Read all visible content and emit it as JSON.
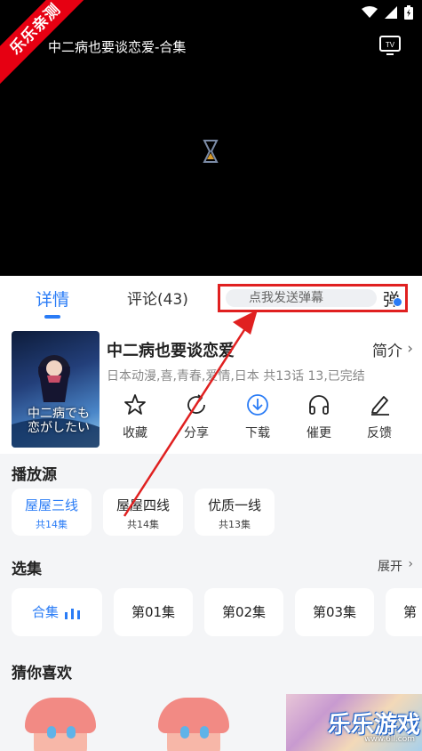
{
  "status_bar": {
    "wifi_icon": "wifi-icon",
    "signal_icon": "signal-icon",
    "battery_icon": "battery-charging-icon"
  },
  "player": {
    "title": "中二病也要谈恋爱-合集",
    "tv_icon": "tv-cast-icon",
    "tv_label": "TV",
    "loading_icon": "hourglass-icon",
    "ribbon": "乐乐亲测"
  },
  "tabs": {
    "detail": "详情",
    "comments": "评论(43)"
  },
  "danmaku": {
    "placeholder": "点我发送弹幕",
    "toggle": "弹"
  },
  "show": {
    "title": "中二病也要谈恋爱",
    "intro": "简介",
    "meta": "日本动漫,喜,青春,爱情,日本 共13话 13,已完结",
    "poster_text": "中二病でも恋がしたい"
  },
  "actions": [
    {
      "label": "收藏",
      "icon": "star-icon"
    },
    {
      "label": "分享",
      "icon": "share-icon"
    },
    {
      "label": "下载",
      "icon": "download-icon"
    },
    {
      "label": "催更",
      "icon": "headphones-icon"
    },
    {
      "label": "反馈",
      "icon": "edit-icon"
    }
  ],
  "sources": {
    "title": "播放源",
    "items": [
      {
        "name": "屋屋三线",
        "count": "共14集",
        "active": true
      },
      {
        "name": "屋屋四线",
        "count": "共14集",
        "active": false
      },
      {
        "name": "优质一线",
        "count": "共13集",
        "active": false
      }
    ]
  },
  "episodes": {
    "title": "选集",
    "expand": "展开",
    "items": [
      "合集",
      "第01集",
      "第02集",
      "第03集",
      "第"
    ]
  },
  "recommend": {
    "title": "猜你喜欢"
  },
  "watermark": {
    "text": "乐乐游戏",
    "url": "www.6ll.com"
  },
  "colors": {
    "accent": "#2a7cf6",
    "annotation_red": "#e02020"
  }
}
